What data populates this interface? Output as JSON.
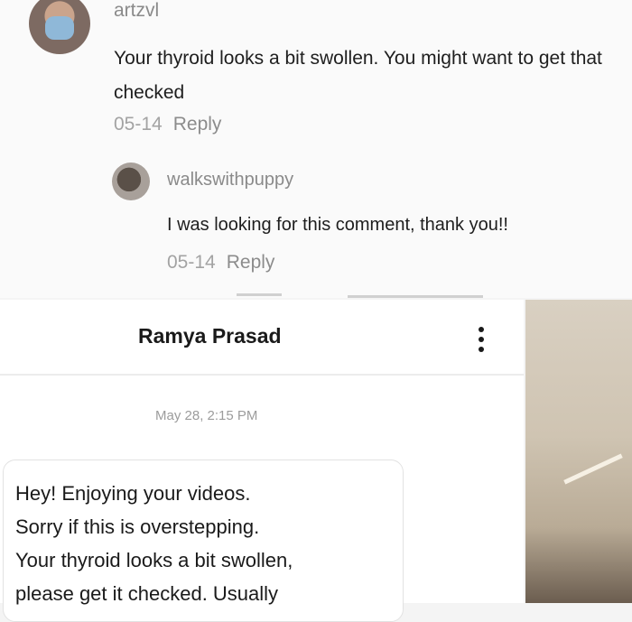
{
  "comments": {
    "parent": {
      "username": "artzvl",
      "text": "Your thyroid looks a bit swollen. You might want to get that checked",
      "date": "05-14",
      "reply_label": "Reply"
    },
    "reply": {
      "username": "walkswithpuppy",
      "text": "I was looking for this comment, thank you!!",
      "date": "05-14",
      "reply_label": "Reply"
    }
  },
  "message": {
    "contact_name": "Ramya Prasad",
    "timestamp": "May 28, 2:15 PM",
    "body": "Hey! Enjoying your videos.\nSorry if this is overstepping.\nYour thyroid looks a bit swollen,\nplease get it checked. Usually"
  },
  "icons": {
    "more": "vertical-ellipsis"
  },
  "colors": {
    "username": "#8a8a8a",
    "date": "#a3a3a3",
    "text": "#1e1e1e"
  }
}
